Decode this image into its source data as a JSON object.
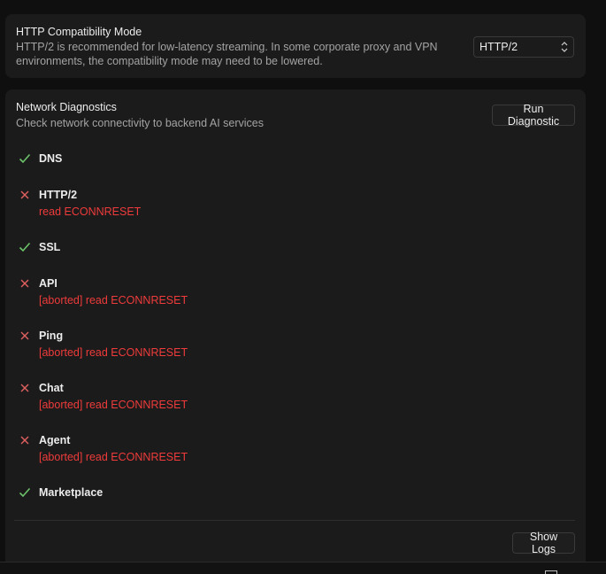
{
  "compat": {
    "title": "HTTP Compatibility Mode",
    "description": "HTTP/2 is recommended for low-latency streaming. In some corporate proxy and VPN environments, the compatibility mode may need to be lowered.",
    "selected": "HTTP/2"
  },
  "diagnostics": {
    "title": "Network Diagnostics",
    "description": "Check network connectivity to backend AI services",
    "run_label": "Run Diagnostic",
    "logs_label": "Show Logs",
    "colors": {
      "ok": "#6cc36a",
      "fail": "#e06060",
      "error_text": "#ef3b3b"
    },
    "checks": [
      {
        "name": "DNS",
        "status": "ok",
        "icon": "check-icon"
      },
      {
        "name": "HTTP/2",
        "status": "fail",
        "icon": "x-icon",
        "error": "read ECONNRESET"
      },
      {
        "name": "SSL",
        "status": "ok",
        "icon": "check-icon"
      },
      {
        "name": "API",
        "status": "fail",
        "icon": "x-icon",
        "error": "[aborted] read ECONNRESET"
      },
      {
        "name": "Ping",
        "status": "fail",
        "icon": "x-icon",
        "error": "[aborted] read ECONNRESET"
      },
      {
        "name": "Chat",
        "status": "fail",
        "icon": "x-icon",
        "error": "[aborted] read ECONNRESET"
      },
      {
        "name": "Agent",
        "status": "fail",
        "icon": "x-icon",
        "error": "[aborted] read ECONNRESET"
      },
      {
        "name": "Marketplace",
        "status": "ok",
        "icon": "check-icon"
      }
    ]
  }
}
